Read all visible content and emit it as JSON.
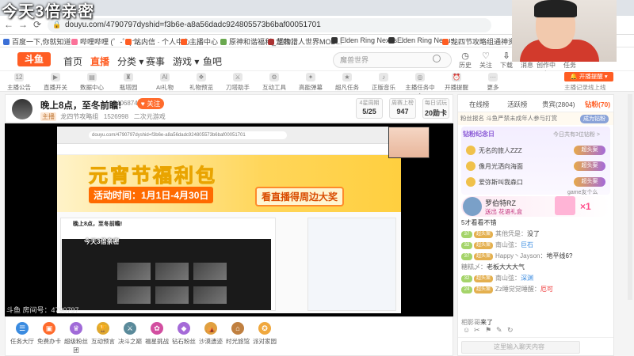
{
  "overlay": {
    "caption": "今天3倍亲密"
  },
  "browser": {
    "url": "douyu.com/4790797dyshid=f3b6e-a8a56dadc924805573b6baf00051701",
    "nav": [
      "←",
      "→",
      "⟳"
    ],
    "bookmarks": [
      {
        "label": "百度一下,你就知道",
        "color": "#3b6fd6"
      },
      {
        "label": "哔哩哔哩 (゜-゜)つ...",
        "color": "#fb7299"
      },
      {
        "label": "站内信 · 个人中心 ·...",
        "color": "#ff5d23"
      },
      {
        "label": "主播中心",
        "color": "#ff5d23"
      },
      {
        "label": "原神和谐福利_龙四...",
        "color": "#6aa84f"
      },
      {
        "label": "怪物猎人世界MOD...",
        "color": "#a33"
      },
      {
        "label": "Elden Ring Nexus...",
        "color": "#333"
      },
      {
        "label": "Elden Ring Nexus...",
        "color": "#333"
      },
      {
        "label": "龙四节攻略组通神资...",
        "color": "#ff5d23"
      }
    ]
  },
  "header": {
    "logo": "斗鱼",
    "nav": [
      {
        "label": "首页",
        "active": false
      },
      {
        "label": "直播",
        "active": true
      },
      {
        "label": "分类 ▾",
        "active": false
      },
      {
        "label": "赛事",
        "active": false
      },
      {
        "label": "游戏 ▾",
        "active": false
      },
      {
        "label": "鱼吧",
        "active": false
      }
    ],
    "search_placeholder": "魔兽世界",
    "right_icons": [
      {
        "label": "历史",
        "glyph": "◷"
      },
      {
        "label": "关注",
        "glyph": "♡"
      },
      {
        "label": "下载",
        "glyph": "⇩"
      },
      {
        "label": "消息",
        "glyph": "✉"
      },
      {
        "label": "创作中心",
        "glyph": "✎"
      },
      {
        "label": "任务",
        "glyph": "☑"
      }
    ]
  },
  "categories": {
    "items": [
      {
        "label": "主播公告",
        "glyph": "12"
      },
      {
        "label": "直播开关",
        "glyph": "▶"
      },
      {
        "label": "数据中心",
        "glyph": "▤"
      },
      {
        "label": "瓶塔园",
        "glyph": "♜"
      },
      {
        "label": "AI礼物",
        "glyph": "AI"
      },
      {
        "label": "礼物预览",
        "glyph": "❖"
      },
      {
        "label": "刀塔助手",
        "glyph": "⚔"
      },
      {
        "label": "互动工具",
        "glyph": "⚙"
      },
      {
        "label": "高能弹幕",
        "glyph": "✦"
      },
      {
        "label": "超凡任务",
        "glyph": "★"
      },
      {
        "label": "正版音乐",
        "glyph": "♪"
      },
      {
        "label": "主播任务中心",
        "glyph": "◎"
      },
      {
        "label": "开播提醒",
        "glyph": "⏰"
      },
      {
        "label": "更多",
        "glyph": "···"
      }
    ],
    "open_button": "🔔 开播提醒 ▾",
    "open_link": "主播记录线上线"
  },
  "room": {
    "title": "晚上8点，至冬前瞻!",
    "score": "406874",
    "follow_label": "♥ 关注",
    "anchor": "龙四节攻略组",
    "id_count": "1526998",
    "category": "二次元游戏",
    "badge": "主播",
    "stats": [
      {
        "label": "4星周期",
        "value": "5/25"
      },
      {
        "label": "周赛上榜",
        "value": "947"
      },
      {
        "label": "每日试玩",
        "value": "20勋卡"
      }
    ],
    "room_number": "斗鱼 房间号：4790797"
  },
  "inner_stream": {
    "url": "douyu.com/4790797dyshid=f3b6e-a8a56dadc924805573b6baf00051701",
    "banner_big": "元宵节福利包",
    "banner_activity": "活动时间：1月1日-4月30日",
    "banner_watch": "看直播得周边大奖",
    "room_title": "晚上8点，至冬前瞻!",
    "caption": "今天3倍亲密"
  },
  "toolbar": {
    "items": [
      {
        "label": "任务大厅",
        "color": "#3a8be0",
        "glyph": "☰"
      },
      {
        "label": "免费办卡",
        "color": "#ff6b2c",
        "glyph": "▣"
      },
      {
        "label": "超级粉丝团",
        "color": "#a06ad8",
        "glyph": "♛"
      },
      {
        "label": "互动预言",
        "color": "#e0a82e",
        "glyph": "🏆"
      },
      {
        "label": "决斗之巅",
        "color": "#5a8a9a",
        "glyph": "⚔"
      },
      {
        "label": "福星挑战",
        "color": "#d24ea0",
        "glyph": "✿"
      },
      {
        "label": "钻石粉丝",
        "color": "#a56ad8",
        "glyph": "◆"
      },
      {
        "label": "沙漠遗迹",
        "color": "#e0a040",
        "glyph": "⛺"
      },
      {
        "label": "时光旅馆",
        "color": "#c08040",
        "glyph": "⌂"
      },
      {
        "label": "派对家园",
        "color": "#f0a83e",
        "glyph": "✪"
      }
    ]
  },
  "right_panel": {
    "tabs": [
      {
        "label": "在线榜",
        "hot": false
      },
      {
        "label": "活跃榜",
        "hot": false
      },
      {
        "label": "贵宾(2804)",
        "hot": false
      },
      {
        "label": "钻粉(70)",
        "hot": true
      }
    ],
    "notice_prefix": "粉丝报名",
    "notice": "斗鱼严禁未成年人参与打赏",
    "fans_button": "成为钻粉",
    "fans_title": "钻粉纪念日",
    "fans_right": "今日共有3位钻粉 >",
    "ranking": [
      {
        "name": "无名的旅人ZZZ",
        "tag": "超头案"
      },
      {
        "name": "像月光洒向海面",
        "tag": "超头案"
      },
      {
        "name": "爱弥斯叫我森口",
        "tag": "超头案"
      }
    ],
    "gift": {
      "user": "罗伯特RZ",
      "action": "送出 花语礼盒",
      "count": "×1",
      "extra": "game友个么"
    },
    "messages": [
      {
        "lv": "",
        "badge": "",
        "name": "",
        "text": "5才看看不错",
        "cls": ""
      },
      {
        "lv": "37",
        "badge": "超头案",
        "name": "其他凭是：",
        "text": "没了",
        "cls": ""
      },
      {
        "lv": "32",
        "badge": "超头案",
        "name": "南山弦：",
        "text": "巨石",
        "cls": "link"
      },
      {
        "lv": "37",
        "badge": "超头案",
        "name": "Happy丶Jayson：",
        "text": "地平线6?",
        "cls": ""
      },
      {
        "lv": "",
        "badge": "",
        "name": "糖糕乄：",
        "text": "老板大大大气",
        "cls": ""
      },
      {
        "lv": "32",
        "badge": "超头案",
        "name": "南山弦：",
        "text": "深渊",
        "cls": "link"
      },
      {
        "lv": "24",
        "badge": "超头案",
        "name": "Zz睡觉觉睡醒：",
        "text": "厄可",
        "cls": "red"
      },
      {
        "lv": "",
        "badge": "",
        "name": "",
        "text": "",
        "cls": ""
      },
      {
        "lv": "",
        "badge": "",
        "name": "",
        "text": "",
        "cls": ""
      },
      {
        "lv": "",
        "badge": "",
        "name": "相影哥",
        "text": "来了",
        "cls": ""
      }
    ],
    "input_placeholder": "这里输入聊天内容",
    "footer_icons": [
      "☺",
      "✂",
      "⚑",
      "✎",
      "↻"
    ]
  }
}
